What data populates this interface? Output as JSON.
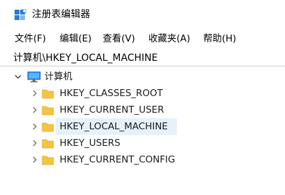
{
  "window": {
    "title": "注册表编辑器",
    "icon": "registry-editor-icon"
  },
  "menu": {
    "items": [
      {
        "label": "文件(F)"
      },
      {
        "label": "编辑(E)"
      },
      {
        "label": "查看(V)"
      },
      {
        "label": "收藏夹(A)"
      },
      {
        "label": "帮助(H)"
      }
    ]
  },
  "address": {
    "path": "计算机\\HKEY_LOCAL_MACHINE"
  },
  "tree": {
    "root": {
      "label": "计算机",
      "icon": "computer-icon",
      "expanded": true
    },
    "keys": [
      {
        "label": "HKEY_CLASSES_ROOT",
        "selected": false
      },
      {
        "label": "HKEY_CURRENT_USER",
        "selected": false
      },
      {
        "label": "HKEY_LOCAL_MACHINE",
        "selected": true
      },
      {
        "label": "HKEY_USERS",
        "selected": false
      },
      {
        "label": "HKEY_CURRENT_CONFIG",
        "selected": false
      }
    ]
  },
  "colors": {
    "selection": "#e5f1fb",
    "folder": "#f4c542",
    "folder_dark": "#e0a81e",
    "icon_blue": "#2b7bd6"
  }
}
